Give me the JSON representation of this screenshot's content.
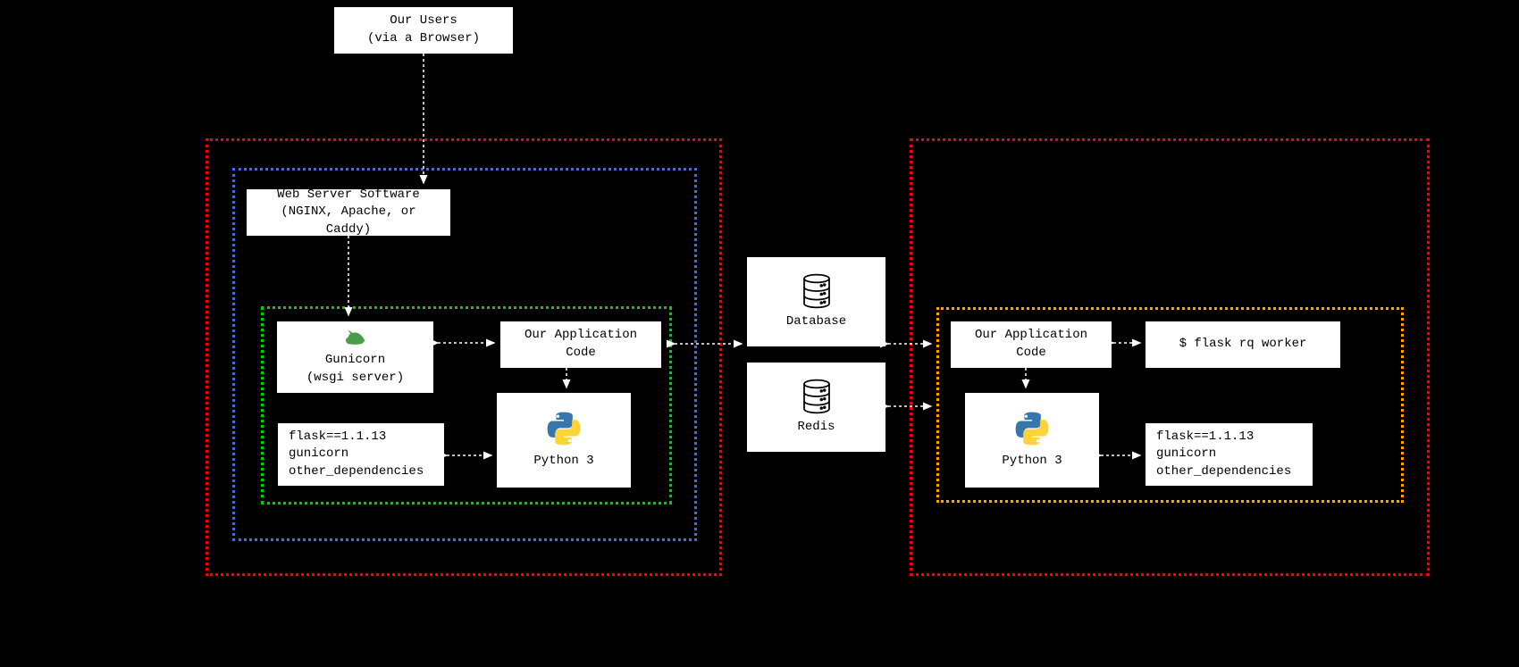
{
  "users": {
    "line1": "Our Users",
    "line2": "(via a Browser)"
  },
  "webserver": {
    "line1": "Web Server Software",
    "line2": "(NGINX, Apache, or Caddy)"
  },
  "gunicorn": {
    "line1": "Gunicorn",
    "line2": "(wsgi server)"
  },
  "appcode_left": "Our Application Code",
  "appcode_right": "Our Application Code",
  "python_left": "Python 3",
  "python_right": "Python 3",
  "deps_left": {
    "line1": "flask==1.1.13",
    "line2": "gunicorn",
    "line3": "other_dependencies"
  },
  "deps_right": {
    "line1": "flask==1.1.13",
    "line2": "gunicorn",
    "line3": "other_dependencies"
  },
  "database": "Database",
  "redis": "Redis",
  "worker_cmd": "$ flask rq worker"
}
